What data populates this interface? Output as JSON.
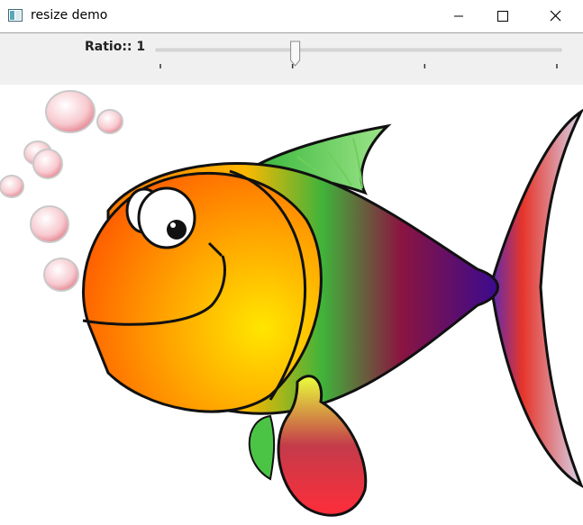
{
  "window": {
    "title": "resize demo",
    "icon": "app-window-icon",
    "controls": [
      "minimize-icon",
      "maximize-icon",
      "close-icon"
    ]
  },
  "trackbar": {
    "label": "Ratio::",
    "value": "1",
    "position_fraction": 0.34,
    "tick_count": 4
  },
  "image": {
    "subject": "colorful cartoon fish with bubbles",
    "colors": {
      "body_orange": "#ff6a00",
      "body_yellow": "#ffe000",
      "green": "#43c83a",
      "purple": "#4b0a8c",
      "red": "#e8222e",
      "bubble": "#f4b5bd"
    }
  }
}
